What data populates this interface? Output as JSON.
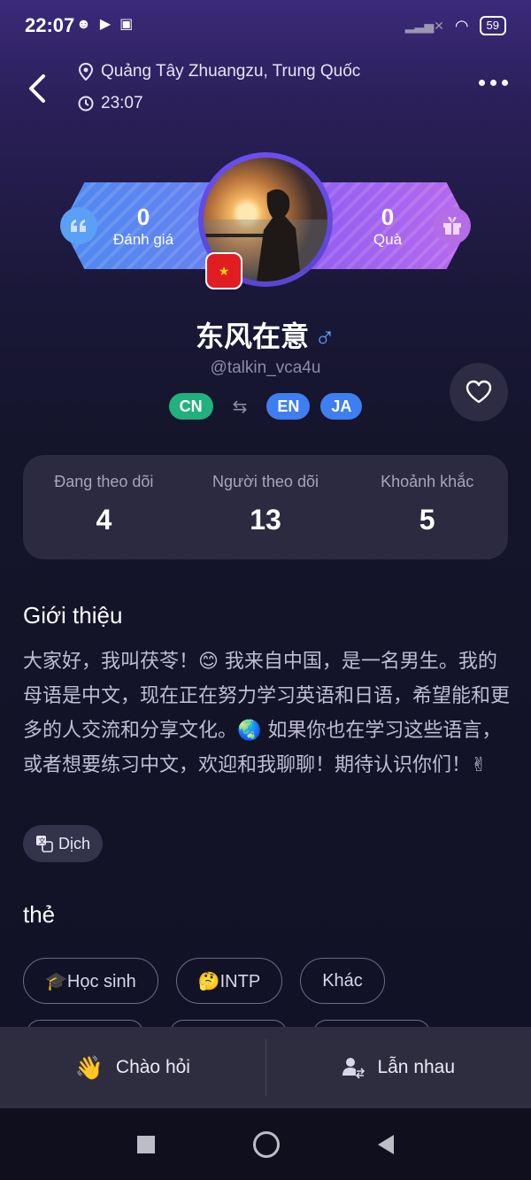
{
  "status_bar": {
    "time": "22:07",
    "battery": "59"
  },
  "header": {
    "location": "Quảng Tây Zhuangzu, Trung Quốc",
    "local_time": "23:07"
  },
  "banner": {
    "reviews": {
      "count": "0",
      "label": "Đánh giá"
    },
    "gifts": {
      "count": "0",
      "label": "Quà"
    }
  },
  "profile": {
    "name": "东风在意",
    "gender_symbol": "♂",
    "handle": "@talkin_vca4u",
    "native_language": "CN",
    "learning_languages": [
      "EN",
      "JA"
    ]
  },
  "stats": [
    {
      "label": "Đang theo dõi",
      "value": "4"
    },
    {
      "label": "Người theo dõi",
      "value": "13"
    },
    {
      "label": "Khoảnh khắc",
      "value": "5"
    }
  ],
  "intro": {
    "title": "Giới thiệu",
    "text": "大家好，我叫茯苓！😊 我来自中国，是一名男生。我的母语是中文，现在正在努力学习英语和日语，希望能和更多的人交流和分享文化。🌏 如果你也在学习这些语言，或者想要练习中文，欢迎和我聊聊！期待认识你们！✌",
    "translate_label": "Dịch"
  },
  "tags": {
    "title": "thẻ",
    "items": [
      "🎓Học sinh",
      "🤔INTP",
      "Khác"
    ]
  },
  "actions": {
    "greet_label": "Chào hỏi",
    "match_label": "Lẫn nhau"
  },
  "colors": {
    "accent_blue": "#3f7ef0",
    "accent_green": "#22b07d",
    "card_bg": "#2b2a40"
  }
}
